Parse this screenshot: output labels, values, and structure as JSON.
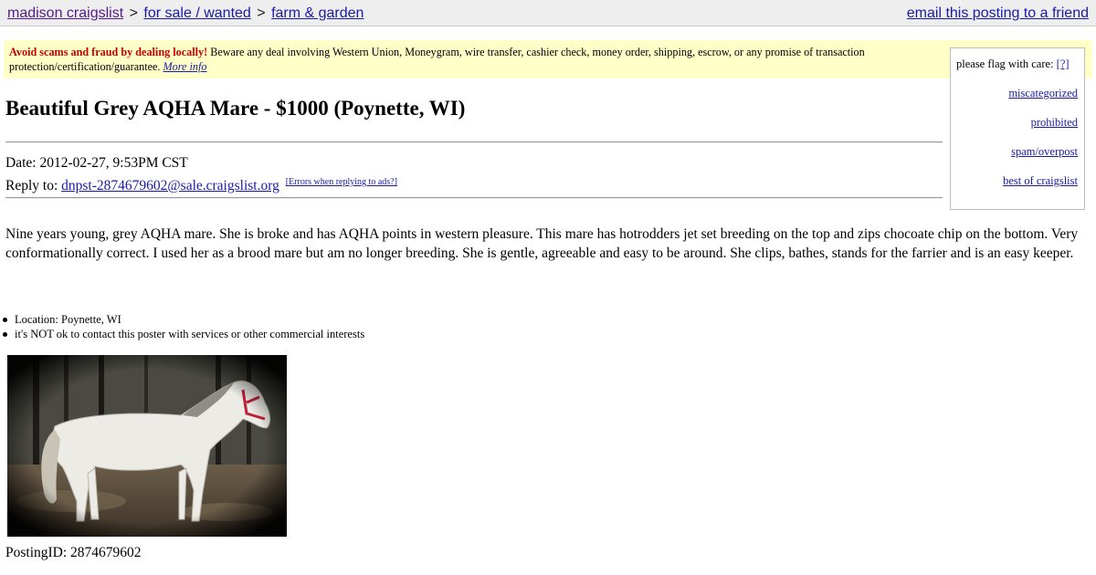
{
  "nav": {
    "crumbs": [
      "madison craigslist",
      "for sale / wanted",
      "farm & garden"
    ],
    "separator": ">",
    "email_link": "email this posting to a friend"
  },
  "scam_notice": {
    "warning": "Avoid scams and fraud by dealing locally!",
    "text": "Beware any deal involving Western Union, Moneygram, wire transfer, cashier check, money order, shipping, escrow, or any promise of transaction protection/certification/guarantee.",
    "more_info": "More info"
  },
  "flag": {
    "label": "please flag with care:",
    "help": "[?]",
    "options": [
      "miscategorized",
      "prohibited",
      "spam/overpost",
      "best of craigslist"
    ]
  },
  "posting": {
    "title": "Beautiful Grey AQHA Mare - $1000 (Poynette, WI)",
    "date": "Date: 2012-02-27, 9:53PM CST",
    "reply_label": "Reply to:",
    "reply_email": "dnpst-2874679602@sale.craigslist.org",
    "reply_errors": "[Errors when replying to ads?]",
    "body": "Nine years young, grey AQHA mare. She is broke and has AQHA points in western pleasure. This mare has hotrodders jet set breeding on the top and zips chocoate chip on the bottom. Very conformationally correct. I used her as a brood mare but am no longer breeding. She is gentle, agreeable and easy to be around. She clips, bathes, stands for the farrier and is an easy keeper.",
    "notes": [
      "Location: Poynette, WI",
      "it's NOT ok to contact this poster with services or other commercial interests"
    ],
    "posting_id": "PostingID: 2874679602"
  },
  "colors": {
    "link": "#1a1aa6",
    "visited": "#551a8b",
    "warning": "#cc0000",
    "notice_bg": "#ffffc8",
    "topbar_bg": "#eeeeee"
  }
}
